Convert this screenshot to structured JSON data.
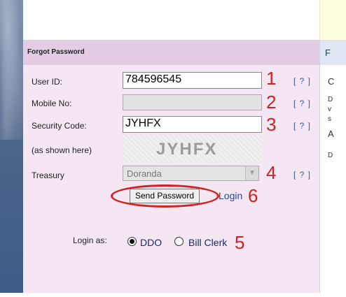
{
  "panel": {
    "title": "Forgot Password"
  },
  "right_col": {
    "header": "F",
    "chars": [
      "C",
      "D",
      "v",
      "s",
      "A",
      "D"
    ]
  },
  "form": {
    "user_id_label": "User ID:",
    "user_id_value": "784596545",
    "mobile_label": "Mobile No:",
    "mobile_value": "",
    "security_label": "Security Code:",
    "security_value": "JYHFX",
    "captcha_note": "(as shown here)",
    "captcha_text": "JYHFX",
    "treasury_label": "Treasury",
    "treasury_value": "Doranda",
    "help": "[ ? ]",
    "send_button": "Send Password",
    "login_link": "Login",
    "login_as_label": "Login as:",
    "options": [
      {
        "label": "DDO",
        "selected": true
      },
      {
        "label": "Bill Clerk",
        "selected": false
      }
    ]
  },
  "annotations": [
    "1",
    "2",
    "3",
    "4",
    "5",
    "6"
  ],
  "colors": {
    "panel_bg": "#f4e6f2",
    "header_bg": "#e4cde4",
    "annotation": "#d42020",
    "link": "#2a4aa0"
  }
}
